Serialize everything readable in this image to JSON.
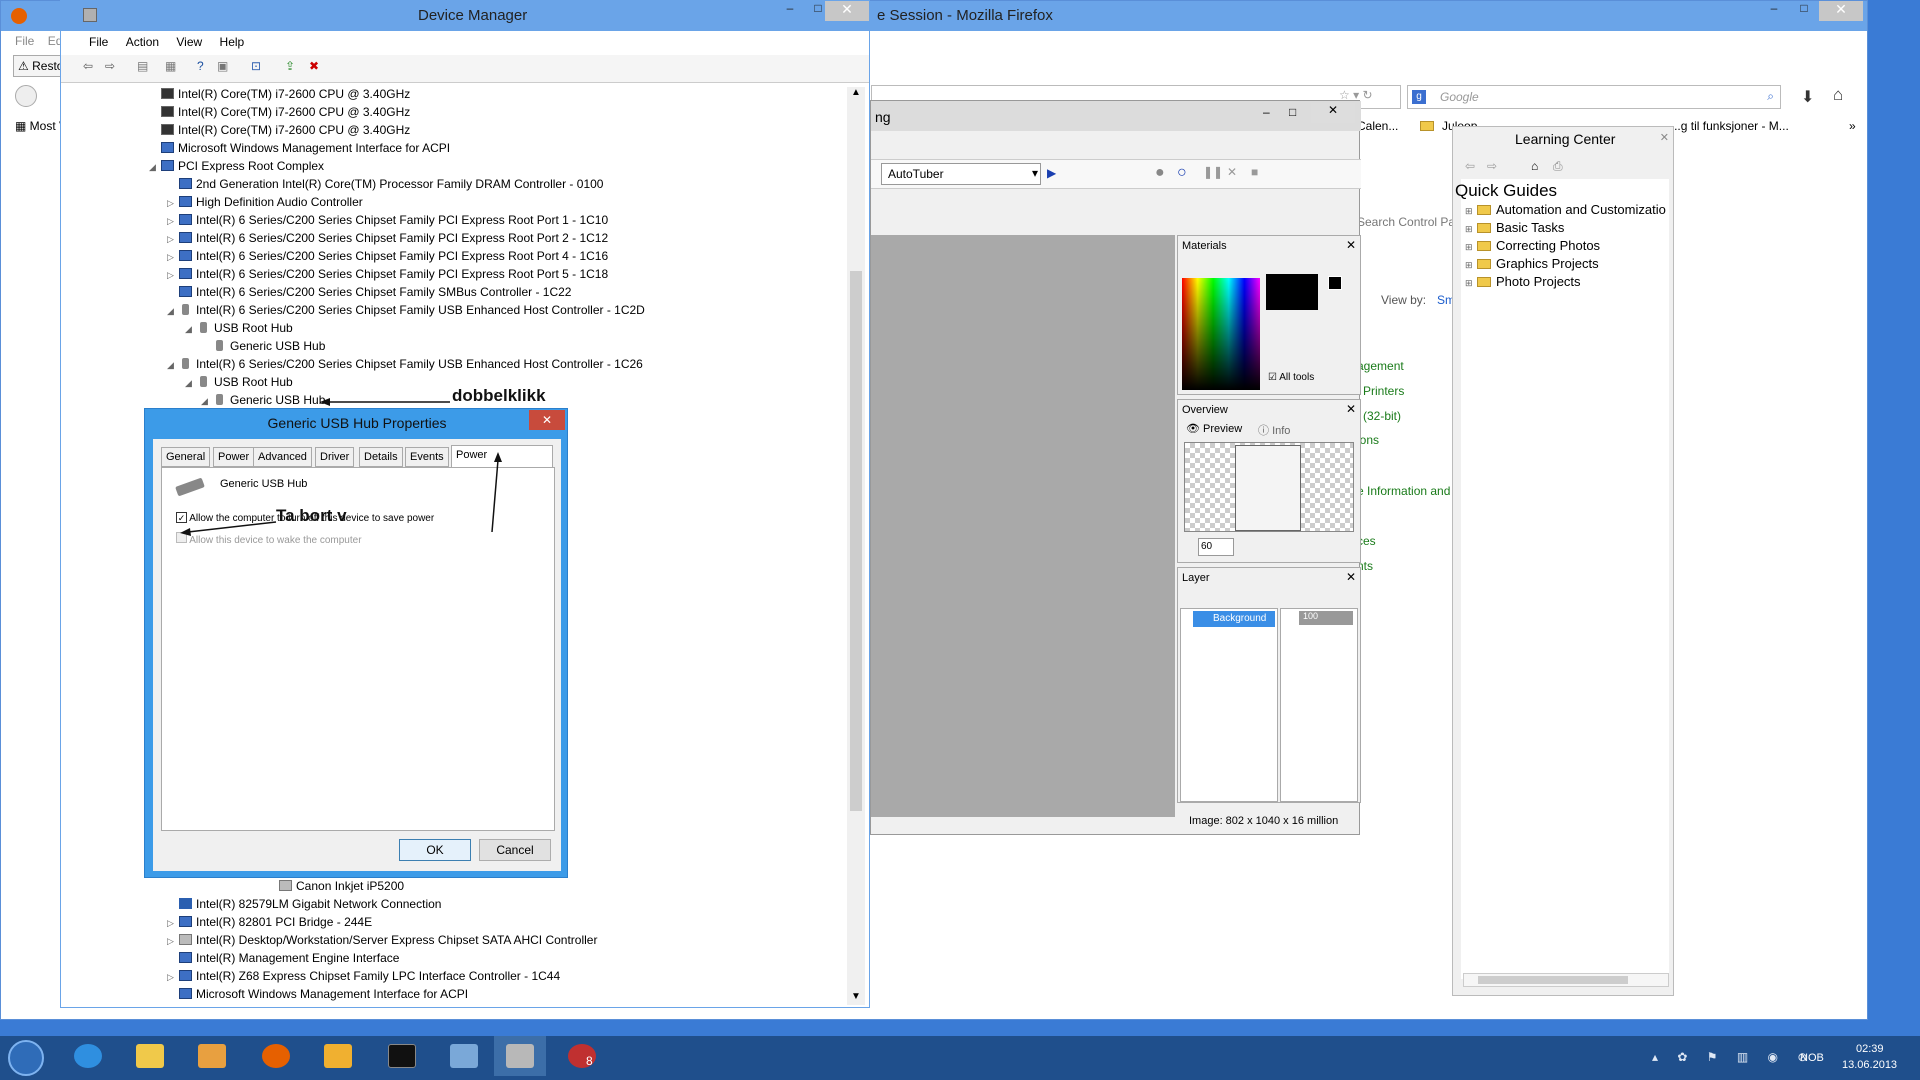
{
  "firefox": {
    "title": "e Session - Mozilla Firefox",
    "menu": [
      "File",
      "Edit"
    ],
    "tab_label": "Restore",
    "bookmark": "Most V",
    "search_placeholder": "Google",
    "bookmarks": [
      "Calen...",
      "Juleop",
      "...",
      "...g til funksjoner - M..."
    ],
    "view_by": "View by:",
    "view_by_value": "Sm",
    "search_cp": "Search Control Pan",
    "links": [
      "agement",
      "Printers",
      "(32-bit)",
      "ions",
      "e Information and",
      "ces",
      "nts"
    ]
  },
  "device_manager": {
    "title": "Device Manager",
    "menu": [
      "File",
      "Action",
      "View",
      "Help"
    ],
    "tree": [
      {
        "text": "Intel(R) Core(TM) i7-2600 CPU @ 3.40GHz",
        "icon": "cpu"
      },
      {
        "text": "Intel(R) Core(TM) i7-2600 CPU @ 3.40GHz",
        "icon": "cpu"
      },
      {
        "text": "Intel(R) Core(TM) i7-2600 CPU @ 3.40GHz",
        "icon": "cpu"
      },
      {
        "text": "Microsoft Windows Management Interface for ACPI",
        "icon": "dev"
      },
      {
        "text": "PCI Express Root Complex",
        "icon": "dev",
        "exp": "◢"
      },
      {
        "text": "2nd Generation Intel(R) Core(TM) Processor Family DRAM Controller - 0100",
        "icon": "dev"
      },
      {
        "text": "High Definition Audio Controller",
        "icon": "dev",
        "exp": "▷"
      },
      {
        "text": "Intel(R) 6 Series/C200 Series Chipset Family PCI Express Root Port 1 - 1C10",
        "icon": "dev",
        "exp": "▷"
      },
      {
        "text": "Intel(R) 6 Series/C200 Series Chipset Family PCI Express Root Port 2 - 1C12",
        "icon": "dev",
        "exp": "▷"
      },
      {
        "text": "Intel(R) 6 Series/C200 Series Chipset Family PCI Express Root Port 4 - 1C16",
        "icon": "dev",
        "exp": "▷"
      },
      {
        "text": "Intel(R) 6 Series/C200 Series Chipset Family PCI Express Root Port 5 - 1C18",
        "icon": "dev",
        "exp": "▷"
      },
      {
        "text": "Intel(R) 6 Series/C200 Series Chipset Family SMBus Controller - 1C22",
        "icon": "dev"
      },
      {
        "text": "Intel(R) 6 Series/C200 Series Chipset Family USB Enhanced Host Controller - 1C2D",
        "icon": "usb",
        "exp": "◢"
      },
      {
        "text": "USB Root Hub",
        "icon": "usb",
        "exp": "◢"
      },
      {
        "text": "Generic USB Hub",
        "icon": "usb"
      },
      {
        "text": "Intel(R) 6 Series/C200 Series Chipset Family USB Enhanced Host Controller - 1C26",
        "icon": "usb",
        "exp": "◢"
      },
      {
        "text": "USB Root Hub",
        "icon": "usb",
        "exp": "◢"
      },
      {
        "text": "Generic USB Hub",
        "icon": "usb",
        "exp": "◢"
      }
    ],
    "tree_bottom": [
      {
        "text": "Canon Inkjet iP5200",
        "icon": "prn"
      },
      {
        "text": "Intel(R) 82579LM Gigabit Network Connection",
        "icon": "net"
      },
      {
        "text": "Intel(R) 82801 PCI Bridge - 244E",
        "icon": "dev",
        "exp": "▷"
      },
      {
        "text": "Intel(R) Desktop/Workstation/Server Express Chipset SATA AHCI Controller",
        "icon": "prn",
        "exp": "▷"
      },
      {
        "text": "Intel(R) Management Engine Interface",
        "icon": "dev"
      },
      {
        "text": "Intel(R) Z68 Express Chipset Family LPC Interface Controller - 1C44",
        "icon": "dev",
        "exp": "▷"
      },
      {
        "text": "Microsoft Windows Management Interface for ACPI",
        "icon": "dev"
      }
    ]
  },
  "annotations": {
    "double_click": "dobbelklikk",
    "remove": "Ta bort v"
  },
  "dialog": {
    "title": "Generic USB Hub Properties",
    "tabs": [
      "General",
      "Power",
      "Advanced",
      "Driver",
      "Details",
      "Events",
      "Power Management"
    ],
    "device_name": "Generic USB Hub",
    "check1": "Allow the computer to turn off this device to save power",
    "check2": "Allow this device to wake the computer",
    "ok": "OK",
    "cancel": "Cancel"
  },
  "psp": {
    "title_fragment": "ng",
    "script_select": "AutoTuber",
    "materials": "Materials",
    "all_tools": "All tools",
    "overview": "Overview",
    "preview": "Preview",
    "info": "Info",
    "zoom": "60",
    "layer": "Layer",
    "background": "Background",
    "opacity": "100",
    "status": "Image:  802 x 1040 x 16 million"
  },
  "learning_center": {
    "title": "Learning Center",
    "heading": "Quick Guides",
    "items": [
      "Automation and Customizatio",
      "Basic Tasks",
      "Correcting Photos",
      "Graphics Projects",
      "Photo Projects"
    ]
  },
  "taskbar": {
    "lang": "NOB",
    "time": "02:39",
    "date": "13.06.2013",
    "psp_badge": "8"
  },
  "colors": {
    "desktop": "#3a7bd5",
    "titlebar": "#6aa4e8",
    "dialog_border": "#3c9be8",
    "annotation": "#111111"
  }
}
